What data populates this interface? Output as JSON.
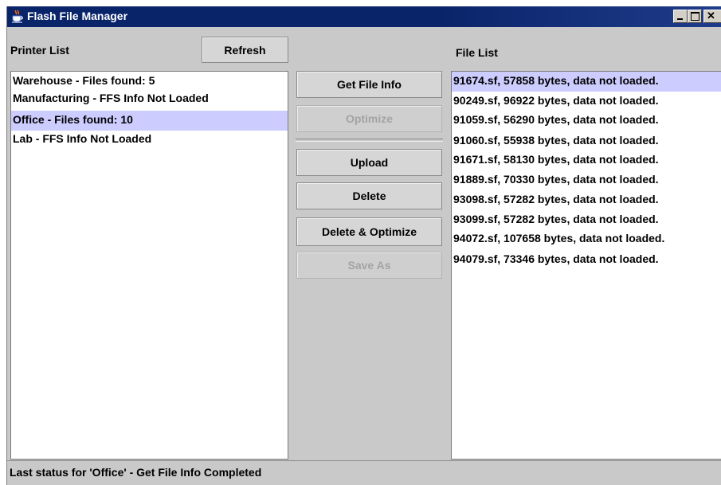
{
  "window": {
    "title": "Flash File Manager",
    "app_icon": "java-coffee-cup-icon"
  },
  "printer_panel": {
    "label": "Printer List",
    "refresh_label": "Refresh",
    "items": [
      "Warehouse - Files found: 5",
      "Manufacturing - FFS Info Not Loaded",
      "Office - Files found: 10",
      "Lab - FFS Info Not Loaded"
    ],
    "selected": "Office - Files found: 10"
  },
  "actions": {
    "get_file_info": "Get File Info",
    "optimize": "Optimize",
    "upload": "Upload",
    "delete": "Delete",
    "delete_optimize": "Delete & Optimize",
    "save_as": "Save As",
    "disabled": [
      "Optimize",
      "Save As"
    ]
  },
  "file_panel": {
    "label": "File List",
    "items": [
      "91674.sf, 57858 bytes, data not loaded.",
      "90249.sf, 96922 bytes, data not loaded.",
      "91059.sf, 56290 bytes, data not loaded.",
      "91060.sf, 55938 bytes, data not loaded.",
      "91671.sf, 58130 bytes, data not loaded.",
      "91889.sf, 70330 bytes, data not loaded.",
      "93098.sf, 57282 bytes, data not loaded.",
      "93099.sf, 57282 bytes, data not loaded.",
      "94072.sf, 107658 bytes, data not loaded.",
      "94079.sf, 73346 bytes, data not loaded."
    ],
    "selected": "91674.sf, 57858 bytes, data not loaded."
  },
  "status": {
    "text": "Last status for 'Office' - Get File Info Completed"
  },
  "colors": {
    "titlebar": "#0a246a",
    "selection": "#ccccff",
    "panel": "#c9c9c9"
  }
}
